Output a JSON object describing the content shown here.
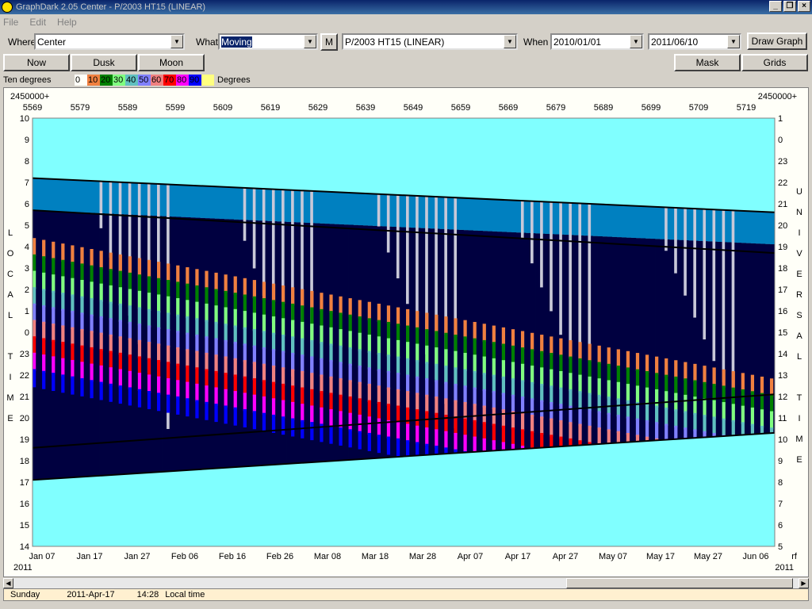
{
  "window": {
    "title": "GraphDark 2.05  Center  -  P/2003 HT15 (LINEAR)"
  },
  "menu": [
    "File",
    "Edit",
    "Help"
  ],
  "toolbar": {
    "where_label": "Where",
    "where_value": "Center",
    "what_label": "What",
    "what_value": "Moving",
    "m_button": "M",
    "object_value": "P/2003 HT15 (LINEAR)",
    "when_label": "When",
    "date_from": "2010/01/01",
    "date_to": "2011/06/10",
    "draw_button": "Draw Graph"
  },
  "buttons": {
    "now": "Now",
    "dusk": "Dusk",
    "moon": "Moon",
    "mask": "Mask",
    "grids": "Grids"
  },
  "legend": {
    "label": "Ten degrees",
    "suffix": "Degrees",
    "entries": [
      {
        "text": "0",
        "color": "#fffff8"
      },
      {
        "text": "10",
        "color": "#f08040"
      },
      {
        "text": "20",
        "color": "#008000"
      },
      {
        "text": "30",
        "color": "#80ff80"
      },
      {
        "text": "40",
        "color": "#60c0c0"
      },
      {
        "text": "50",
        "color": "#8080ff"
      },
      {
        "text": "60",
        "color": "#f08080"
      },
      {
        "text": "70",
        "color": "#ff0000"
      },
      {
        "text": "80",
        "color": "#ff00ff"
      },
      {
        "text": "90",
        "color": "#0000ff"
      },
      {
        "text": "",
        "color": "#ffff80"
      }
    ]
  },
  "chart_data": {
    "type": "area",
    "jd_prefix_left": "2450000+",
    "jd_prefix_right": "2450000+",
    "jd_ticks": [
      "5569",
      "5579",
      "5589",
      "5599",
      "5609",
      "5619",
      "5629",
      "5639",
      "5649",
      "5659",
      "5669",
      "5679",
      "5689",
      "5699",
      "5709",
      "5719"
    ],
    "date_ticks": [
      "Jan 07",
      "Jan 17",
      "Jan 27",
      "Feb 06",
      "Feb 16",
      "Feb 26",
      "Mar 08",
      "Mar 18",
      "Mar 28",
      "Apr 07",
      "Apr 17",
      "Apr 27",
      "May 07",
      "May 17",
      "May 27",
      "Jun 06"
    ],
    "year_left": "2011",
    "year_right": "2011",
    "right_corner": "rf",
    "local_ticks": [
      "10",
      "9",
      "8",
      "7",
      "6",
      "5",
      "4",
      "3",
      "2",
      "1",
      "0",
      "23",
      "22",
      "21",
      "20",
      "19",
      "18",
      "17",
      "16",
      "15",
      "14"
    ],
    "ut_ticks": [
      "1",
      "0",
      "23",
      "22",
      "21",
      "20",
      "19",
      "18",
      "17",
      "16",
      "15",
      "14",
      "13",
      "12",
      "11",
      "10",
      "9",
      "8",
      "7",
      "6",
      "5"
    ],
    "left_axis_title": [
      "L",
      "O",
      "C",
      "A",
      "L",
      "",
      "T",
      "I",
      "M",
      "E"
    ],
    "right_axis_title": [
      "U",
      "N",
      "I",
      "V",
      "E",
      "R",
      "S",
      "A",
      "L",
      "",
      "T",
      "I",
      "M",
      "E"
    ],
    "colors": {
      "sky": "#80ffff",
      "twilight": "#0080c0",
      "night": "#000040",
      "moon": "#c8c8d8"
    },
    "dark_window_local": {
      "start_date": [
        "Jan 07",
        "Jun 10"
      ],
      "dusk_local": [
        7.2,
        5.6
      ],
      "dawn_local": [
        17.1,
        19.3
      ]
    }
  },
  "status": {
    "day": "Sunday",
    "date": "2011-Apr-17",
    "time": "14:28",
    "mode": "Local time"
  }
}
